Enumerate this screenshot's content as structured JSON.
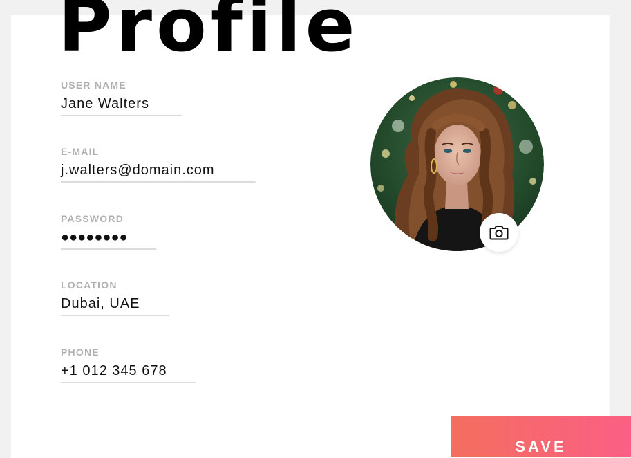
{
  "page": {
    "title": "Profile"
  },
  "fields": [
    {
      "label": "USER NAME",
      "value": "Jane Walters"
    },
    {
      "label": "E-MAIL",
      "value": "j.walters@domain.com"
    },
    {
      "label": "PASSWORD",
      "value": "●●●●●●●●"
    },
    {
      "label": "LOCATION",
      "value": "Dubai, UAE"
    },
    {
      "label": "PHONE",
      "value": "+1 012 345 678"
    }
  ],
  "avatar": {
    "icon": "camera-icon"
  },
  "actions": {
    "save_label": "SAVE"
  },
  "colors": {
    "background": "#f1f1f1",
    "card": "#ffffff",
    "label": "#b0b0b0",
    "underline": "#dcdcdc",
    "save_gradient_start": "#f46e5f",
    "save_gradient_end": "#fb5f85"
  }
}
